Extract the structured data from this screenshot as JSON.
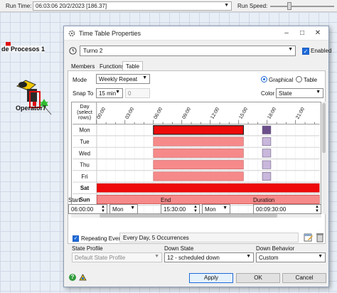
{
  "toolbar": {
    "run_time_label": "Run Time:",
    "run_time_value": "06:03:06  20/2/2023  [186.37]",
    "run_speed_label": "Run Speed:"
  },
  "scene": {
    "process_label": "de Procesos 1",
    "operator_label": "Operator7"
  },
  "dialog": {
    "title": "Time Table Properties",
    "name": "Turno 2",
    "enabled_label": "Enabled",
    "enabled": true,
    "tabs": [
      "Members",
      "Functions",
      "Table"
    ],
    "active_tab": "Table",
    "mode_label": "Mode",
    "mode_value": "Weekly Repeat",
    "view_options": [
      "Graphical",
      "Table"
    ],
    "view_selected": "Graphical",
    "snap_label": "Snap To",
    "snap_value": "15 min",
    "snap_number": "0",
    "color_label": "Color",
    "color_value": "State",
    "grid": {
      "day_header": "Day (select rows)",
      "hours": [
        "00:00",
        "03:00",
        "06:00",
        "09:00",
        "12:00",
        "15:00",
        "18:00",
        "21:00"
      ],
      "days": [
        "Mon",
        "Tue",
        "Wed",
        "Thu",
        "Fri",
        "Sat",
        "Sun"
      ],
      "selected_day": "Mon"
    },
    "start_label": "Start",
    "start_time": "06:00:00",
    "start_day": "Mon",
    "end_label": "End",
    "end_time": "15:30:00",
    "end_day": "Mon",
    "duration_label": "Duration",
    "duration_value": "00:09:30:00",
    "repeating_label": "Repeating Event",
    "repeating": true,
    "repeating_summary": "Every Day, 5 Occurrences",
    "state_profile_label": "State Profile",
    "state_profile_value": "Default State Profile",
    "down_state_label": "Down State",
    "down_state_value": "12 - scheduled down",
    "down_behavior_label": "Down Behavior",
    "down_behavior_value": "Custom",
    "buttons": {
      "apply": "Apply",
      "ok": "OK",
      "cancel": "Cancel"
    },
    "colors": {
      "selected_block": "#ee0a0a",
      "block": "#f68a8a",
      "marker": "#6b4f8a",
      "marker_light": "#c9b8dc",
      "accent": "#1e6ad9"
    }
  }
}
